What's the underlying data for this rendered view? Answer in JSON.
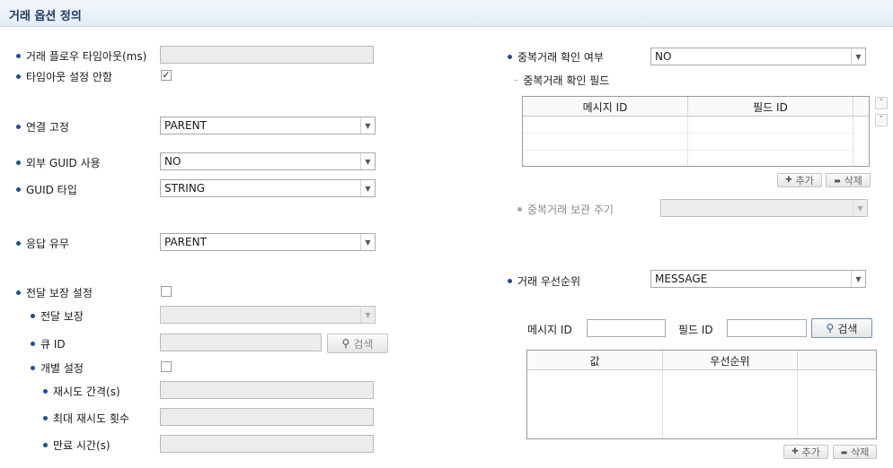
{
  "header": {
    "title": "거래 옵션 정의"
  },
  "left": {
    "flow_timeout": {
      "label": "거래 플로우 타임아웃(ms)",
      "value": ""
    },
    "no_timeout": {
      "label": "타임아웃 설정 안함",
      "checked": true,
      "mark": "✓"
    },
    "fixed_conn": {
      "label": "연결 고정",
      "value": "PARENT"
    },
    "ext_guid": {
      "label": "외부 GUID 사용",
      "value": "NO"
    },
    "guid_type": {
      "label": "GUID 타입",
      "value": "STRING"
    },
    "response": {
      "label": "응답 유무",
      "value": "PARENT"
    },
    "delivery_setting": {
      "label": "전달 보장 설정",
      "checked": false
    },
    "delivery": {
      "label": "전달 보장",
      "value": ""
    },
    "queue_id": {
      "label": "큐 ID",
      "value": "",
      "search_label": "검색"
    },
    "individual": {
      "label": "개별 설정",
      "checked": false
    },
    "retry_interval": {
      "label": "재시도 간격(s)",
      "value": ""
    },
    "max_retry": {
      "label": "최대 재시도 횟수",
      "value": ""
    },
    "expire_time": {
      "label": "만료 시간(s)",
      "value": ""
    }
  },
  "right": {
    "dup_check": {
      "label": "중복거래 확인 여부",
      "value": "NO"
    },
    "dup_field": {
      "label": "중복거래 확인 필드",
      "columns": [
        "메시지 ID",
        "필드 ID"
      ],
      "add_label": "추가",
      "delete_label": "삭제"
    },
    "dup_retention": {
      "label": "중복거래 보관 주기",
      "value": ""
    },
    "priority": {
      "label": "거래 우선순위",
      "value": "MESSAGE"
    },
    "filter": {
      "message_id_label": "메시지 ID",
      "message_id_value": "",
      "field_id_label": "필드 ID",
      "field_id_value": "",
      "search_label": "검색"
    },
    "priority_table": {
      "columns": [
        "값",
        "우선순위"
      ],
      "add_label": "추가",
      "delete_label": "삭제"
    }
  },
  "icons": {
    "caret": "▼",
    "plus": "✚",
    "minus": "▬",
    "search": "🔍",
    "up": "˄",
    "down": "˅"
  }
}
